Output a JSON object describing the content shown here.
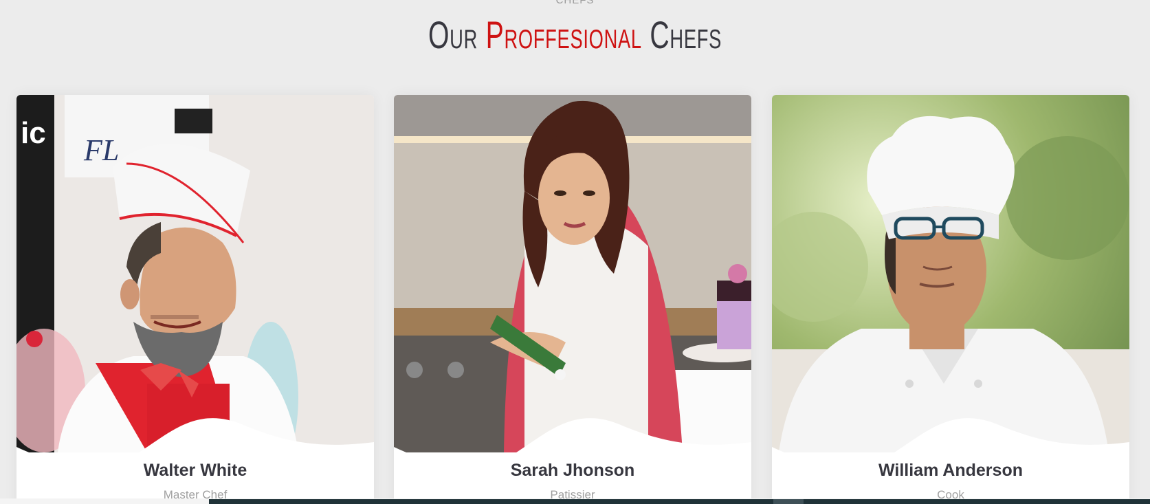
{
  "section": {
    "subtitle": "CHEFS",
    "title_part1": "Our ",
    "title_accent": "Proffesional",
    "title_part2": " Chefs",
    "accent_color": "#ce1212"
  },
  "chefs": [
    {
      "name": "Walter White",
      "role": "Master Chef"
    },
    {
      "name": "Sarah Jhonson",
      "role": "Patissier"
    },
    {
      "name": "William Anderson",
      "role": "Cook"
    }
  ]
}
